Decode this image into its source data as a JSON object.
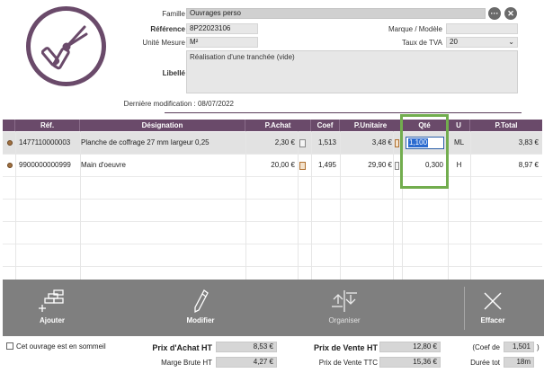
{
  "header": {
    "famille_label": "Famille",
    "famille_value": "Ouvrages perso",
    "reference_label": "Référence",
    "reference_value": "8P22023106",
    "marque_label": "Marque / Modèle",
    "marque_value": "",
    "unite_label": "Unité Mesure",
    "unite_value": "M²",
    "tva_label": "Taux de TVA",
    "tva_value": "20",
    "libelle_label": "Libellé",
    "libelle_value": "Réalisation d'une tranchée (vide)",
    "modif_label": "Dernière modification :",
    "modif_value": "08/07/2022"
  },
  "table": {
    "columns": [
      "Réf.",
      "Désignation",
      "P.Achat",
      "Coef",
      "P.Unitaire",
      "Qté",
      "U",
      "P.Total"
    ],
    "rows": [
      {
        "ref": "1477110000003",
        "designation": "Planche de coffrage 27 mm largeur 0,25",
        "achat": "2,30 €",
        "coef": "1,513",
        "unitaire": "3,48 €",
        "qte": "1,100",
        "u": "ML",
        "total": "3,83 €"
      },
      {
        "ref": "9900000000999",
        "designation": "Main d'oeuvre",
        "achat": "20,00 €",
        "coef": "1,495",
        "unitaire": "29,90 €",
        "qte": "0,300",
        "u": "H",
        "total": "8,97 €"
      }
    ]
  },
  "toolbar": {
    "ajouter": "Ajouter",
    "modifier": "Modifier",
    "organiser": "Organiser",
    "effacer": "Effacer"
  },
  "footer": {
    "sommeil_label": "Cet ouvrage est en sommeil",
    "prix_achat_label": "Prix d'Achat HT",
    "prix_achat_value": "8,53 €",
    "marge_label": "Marge Brute HT",
    "marge_value": "4,27 €",
    "prix_vente_ht_label": "Prix de Vente HT",
    "prix_vente_ht_value": "12,80 €",
    "prix_vente_ttc_label": "Prix de Vente TTC",
    "prix_vente_ttc_value": "15,36 €",
    "coef_label": "(Coef de",
    "coef_value": "1,501",
    "coef_close": ")",
    "duree_label": "Durée tot",
    "duree_value": "18m"
  },
  "colors": {
    "accent": "#6a4a6a",
    "toolbar": "#7f7f7f",
    "highlight": "#72ad4e",
    "selection": "#2b6bd0"
  }
}
